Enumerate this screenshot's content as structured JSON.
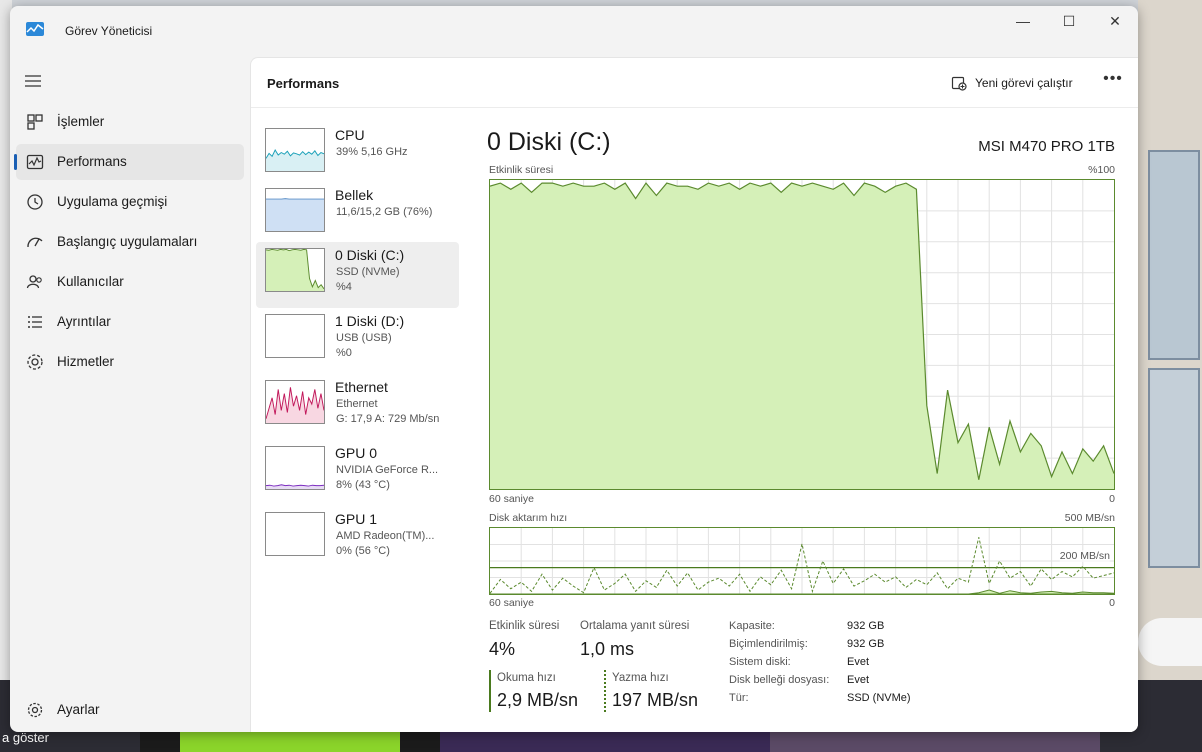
{
  "window": {
    "title": "Görev Yöneticisi",
    "minimize": "—",
    "maximize": "☐",
    "close": "✕"
  },
  "sidebar": {
    "items": [
      {
        "label": "İşlemler",
        "icon": "processes-icon"
      },
      {
        "label": "Performans",
        "icon": "performance-icon",
        "active": true
      },
      {
        "label": "Uygulama geçmişi",
        "icon": "history-icon"
      },
      {
        "label": "Başlangıç uygulamaları",
        "icon": "startup-icon"
      },
      {
        "label": "Kullanıcılar",
        "icon": "users-icon"
      },
      {
        "label": "Ayrıntılar",
        "icon": "details-icon"
      },
      {
        "label": "Hizmetler",
        "icon": "services-icon"
      }
    ],
    "settings": {
      "label": "Ayarlar",
      "icon": "gear-icon"
    }
  },
  "header": {
    "title": "Performans",
    "run_task": "Yeni görevi çalıştır",
    "more": "•••"
  },
  "devices": [
    {
      "name": "CPU",
      "line1": "39% 5,16 GHz",
      "line2": ""
    },
    {
      "name": "Bellek",
      "line1": "11,6/15,2 GB (76%)",
      "line2": ""
    },
    {
      "name": "0 Diski (C:)",
      "line1": "SSD (NVMe)",
      "line2": "%4",
      "selected": true
    },
    {
      "name": "1 Diski (D:)",
      "line1": "USB (USB)",
      "line2": "%0"
    },
    {
      "name": "Ethernet",
      "line1": "Ethernet",
      "line2": "G: 17,9 A: 729 Mb/sn"
    },
    {
      "name": "GPU 0",
      "line1": "NVIDIA GeForce R...",
      "line2": "8% (43 °C)"
    },
    {
      "name": "GPU 1",
      "line1": "AMD Radeon(TM)...",
      "line2": "0% (56 °C)"
    }
  ],
  "detail": {
    "title": "0 Diski (C:)",
    "model": "MSI M470 PRO 1TB",
    "active_time_label": "Etkinlik süresi",
    "active_time_max": "%100",
    "active_time_xlabel": "60 saniye",
    "active_time_min": "0",
    "transfer_label": "Disk aktarım hızı",
    "transfer_max": "500 MB/sn",
    "transfer_ref": "200 MB/sn",
    "transfer_xlabel": "60 saniye",
    "transfer_min": "0",
    "stats": {
      "active_time_label": "Etkinlik süresi",
      "active_time_value": "4%",
      "avg_response_label": "Ortalama yanıt süresi",
      "avg_response_value": "1,0 ms",
      "read_label": "Okuma hızı",
      "read_value": "2,9 MB/sn",
      "write_label": "Yazma hızı",
      "write_value": "197 MB/sn"
    },
    "properties": [
      {
        "label": "Kapasite:",
        "value": "932 GB"
      },
      {
        "label": "Biçimlendirilmiş:",
        "value": "932 GB"
      },
      {
        "label": "Sistem diski:",
        "value": "Evet"
      },
      {
        "label": "Disk belleği dosyası:",
        "value": "Evet"
      },
      {
        "label": "Tür:",
        "value": "SSD (NVMe)"
      }
    ]
  },
  "background": {
    "taskbar_text": "a göster"
  },
  "colors": {
    "accent": "#1a5fb4",
    "disk_fill": "#d5f0b8",
    "disk_line": "#5b8a2e",
    "grid": "#e2e2e2"
  },
  "chart_data": [
    {
      "type": "area",
      "title": "Etkinlik süresi",
      "xlabel": "60 saniye",
      "ylim": [
        0,
        100
      ],
      "y_unit": "%",
      "values": [
        98,
        99,
        97,
        99,
        96,
        99,
        99,
        98,
        99,
        98,
        98,
        99,
        97,
        99,
        94,
        99,
        95,
        99,
        98,
        98,
        97,
        99,
        98,
        99,
        97,
        99,
        98,
        99,
        96,
        99,
        98,
        99,
        98,
        97,
        99,
        95,
        99,
        98,
        96,
        98,
        99,
        97,
        27,
        5,
        32,
        15,
        21,
        3,
        20,
        8,
        22,
        12,
        18,
        14,
        4,
        12,
        5,
        13,
        9,
        14,
        5
      ]
    },
    {
      "type": "line",
      "title": "Disk aktarım hızı",
      "xlabel": "60 saniye",
      "ylim": [
        0,
        500
      ],
      "y_unit": "MB/sn",
      "reference_line": 200,
      "series": [
        {
          "style": "dashed",
          "values": [
            5,
            110,
            40,
            90,
            20,
            150,
            30,
            120,
            60,
            10,
            200,
            30,
            80,
            150,
            20,
            100,
            50,
            180,
            60,
            160,
            30,
            90,
            120,
            60,
            150,
            20,
            130,
            70,
            180,
            40,
            380,
            20,
            250,
            80,
            190,
            60,
            100,
            150,
            90,
            130,
            50,
            110,
            70,
            160,
            40,
            120,
            90,
            430,
            80,
            250,
            120,
            170,
            60,
            190,
            110,
            170,
            130,
            210,
            120,
            140,
            160
          ]
        },
        {
          "style": "solid",
          "values": [
            0,
            0,
            0,
            0,
            0,
            0,
            0,
            0,
            0,
            0,
            0,
            0,
            0,
            0,
            0,
            0,
            0,
            0,
            0,
            0,
            0,
            0,
            0,
            0,
            0,
            0,
            0,
            0,
            0,
            0,
            0,
            0,
            0,
            0,
            0,
            0,
            0,
            0,
            0,
            0,
            0,
            0,
            0,
            0,
            0,
            0,
            0,
            10,
            30,
            5,
            25,
            10,
            5,
            15,
            20,
            10,
            5,
            15,
            10,
            10,
            5
          ]
        }
      ]
    }
  ]
}
